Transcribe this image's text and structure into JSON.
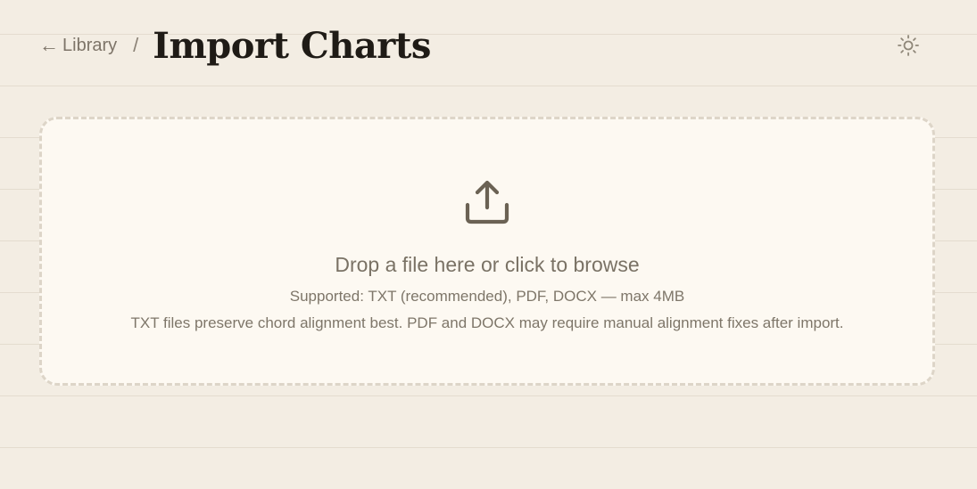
{
  "header": {
    "back_arrow": "←",
    "back_label": "Library",
    "separator": "/",
    "title": "Import Charts",
    "theme_toggle_icon": "sun-icon"
  },
  "dropzone": {
    "icon": "upload-icon",
    "title": "Drop a file here or click to browse",
    "supported": "Supported: TXT (recommended), PDF, DOCX — max 4MB",
    "hint": "TXT files preserve chord alignment best. PDF and DOCX may require manual alignment fixes after import."
  },
  "colors": {
    "background": "#f3ede3",
    "dropzone_bg": "#fdf9f2",
    "dropzone_border": "#ddd5c8",
    "title_text": "#1f1b16",
    "muted_text": "#7a7265",
    "icon": "#6b6254"
  }
}
